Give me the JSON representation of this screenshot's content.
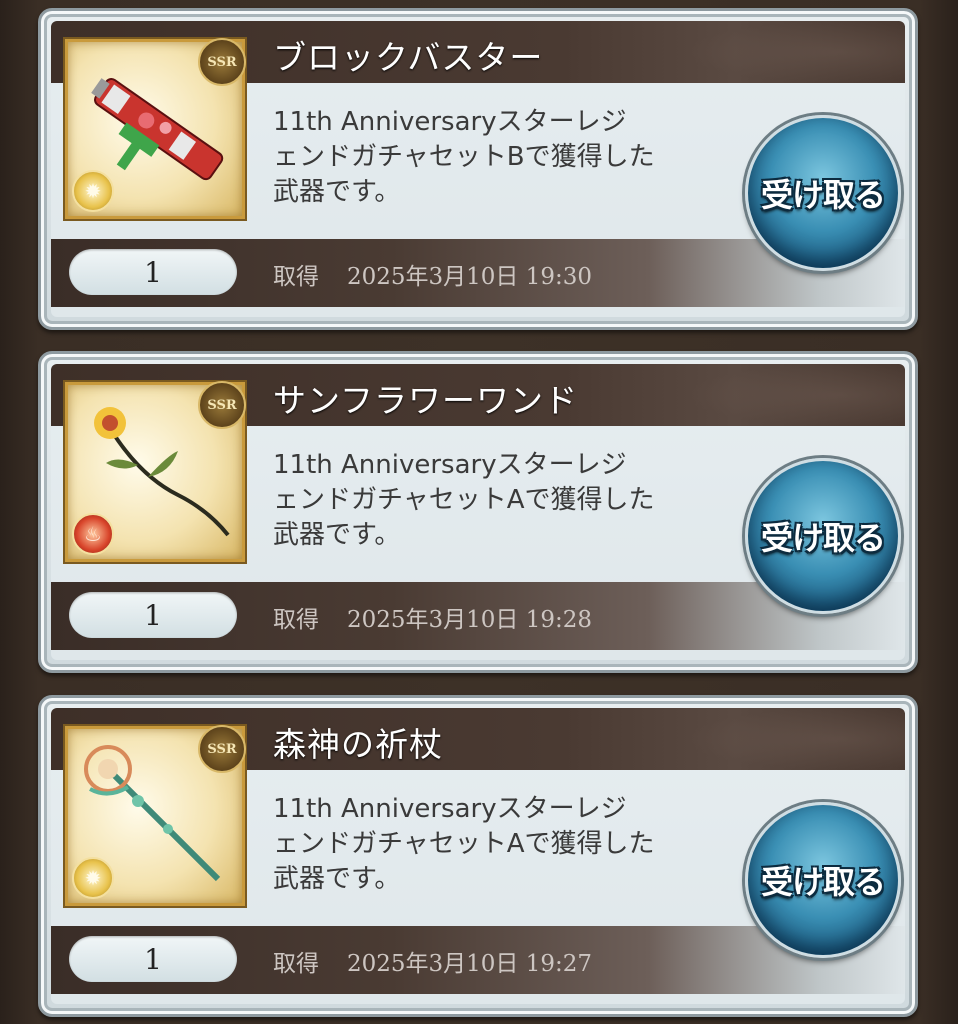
{
  "items": [
    {
      "name": "ブロックバスター",
      "rarity": "SSR",
      "element": "light",
      "element_icon": "light-element-icon",
      "weapon_icon": "launcher-weapon-icon",
      "description": "11th Anniversaryスターレジェンドガチャセットで獲得した武器です。",
      "description_lines": [
        "11th Anniversaryスターレジ",
        "ェンドガチャセットBで獲得した",
        "武器です。"
      ],
      "quantity": "1",
      "acquired_label": "取得",
      "acquired_at": "2025年3月10日 19:30",
      "receive_label": "受け取る"
    },
    {
      "name": "サンフラワーワンド",
      "rarity": "SSR",
      "element": "fire",
      "element_icon": "fire-element-icon",
      "weapon_icon": "sunflower-wand-icon",
      "description_lines": [
        "11th Anniversaryスターレジ",
        "ェンドガチャセットAで獲得した",
        "武器です。"
      ],
      "quantity": "1",
      "acquired_label": "取得",
      "acquired_at": "2025年3月10日 19:28",
      "receive_label": "受け取る"
    },
    {
      "name": "森神の祈杖",
      "rarity": "SSR",
      "element": "light",
      "element_icon": "light-element-icon",
      "weapon_icon": "staff-weapon-icon",
      "description_lines": [
        "11th Anniversaryスターレジ",
        "ェンドガチャセットAで獲得した",
        "武器です。"
      ],
      "quantity": "1",
      "acquired_label": "取得",
      "acquired_at": "2025年3月10日 19:27",
      "receive_label": "受け取る"
    }
  ]
}
